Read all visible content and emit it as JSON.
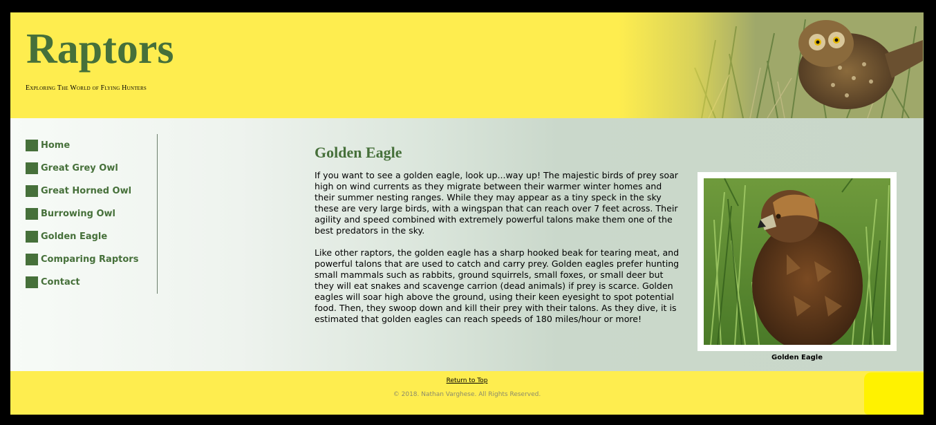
{
  "header": {
    "site_title": "Raptors",
    "tagline": "Exploring The World of Flying Hunters"
  },
  "nav": {
    "items": [
      {
        "label": "Home"
      },
      {
        "label": "Great Grey Owl"
      },
      {
        "label": "Great Horned Owl"
      },
      {
        "label": "Burrowing Owl"
      },
      {
        "label": "Golden Eagle"
      },
      {
        "label": "Comparing Raptors"
      },
      {
        "label": "Contact"
      }
    ]
  },
  "article": {
    "title": "Golden Eagle",
    "paragraphs": [
      "If you want to see a golden eagle, look up...way up! The majestic birds of prey soar high on wind currents as they migrate between their warmer winter homes and their summer nesting ranges. While they may appear as a tiny speck in the sky these are very large birds, with a wingspan that can reach over 7 feet across. Their agility and speed combined with extremely powerful talons make them one of the best predators in the sky.",
      "Like other raptors, the golden eagle has a sharp hooked beak for tearing meat, and powerful talons that are used to catch and carry prey. Golden eagles prefer hunting small mammals such as rabbits, ground squirrels, small foxes, or small deer but they will eat snakes and scavenge carrion (dead animals) if prey is scarce. Golden eagles will soar high above the ground, using their keen eyesight to spot potential food. Then, they swoop down and kill their prey with their talons. As they dive, it is estimated that golden eagles can reach speeds of 180 miles/hour or more!"
    ],
    "figure_caption": "Golden Eagle"
  },
  "footer": {
    "return_to_top": "Return to Top",
    "copyright": "© 2018. Nathan Varghese. All Rights Reserved."
  },
  "colors": {
    "accent_green": "#46703a",
    "header_yellow": "#feed4f"
  }
}
